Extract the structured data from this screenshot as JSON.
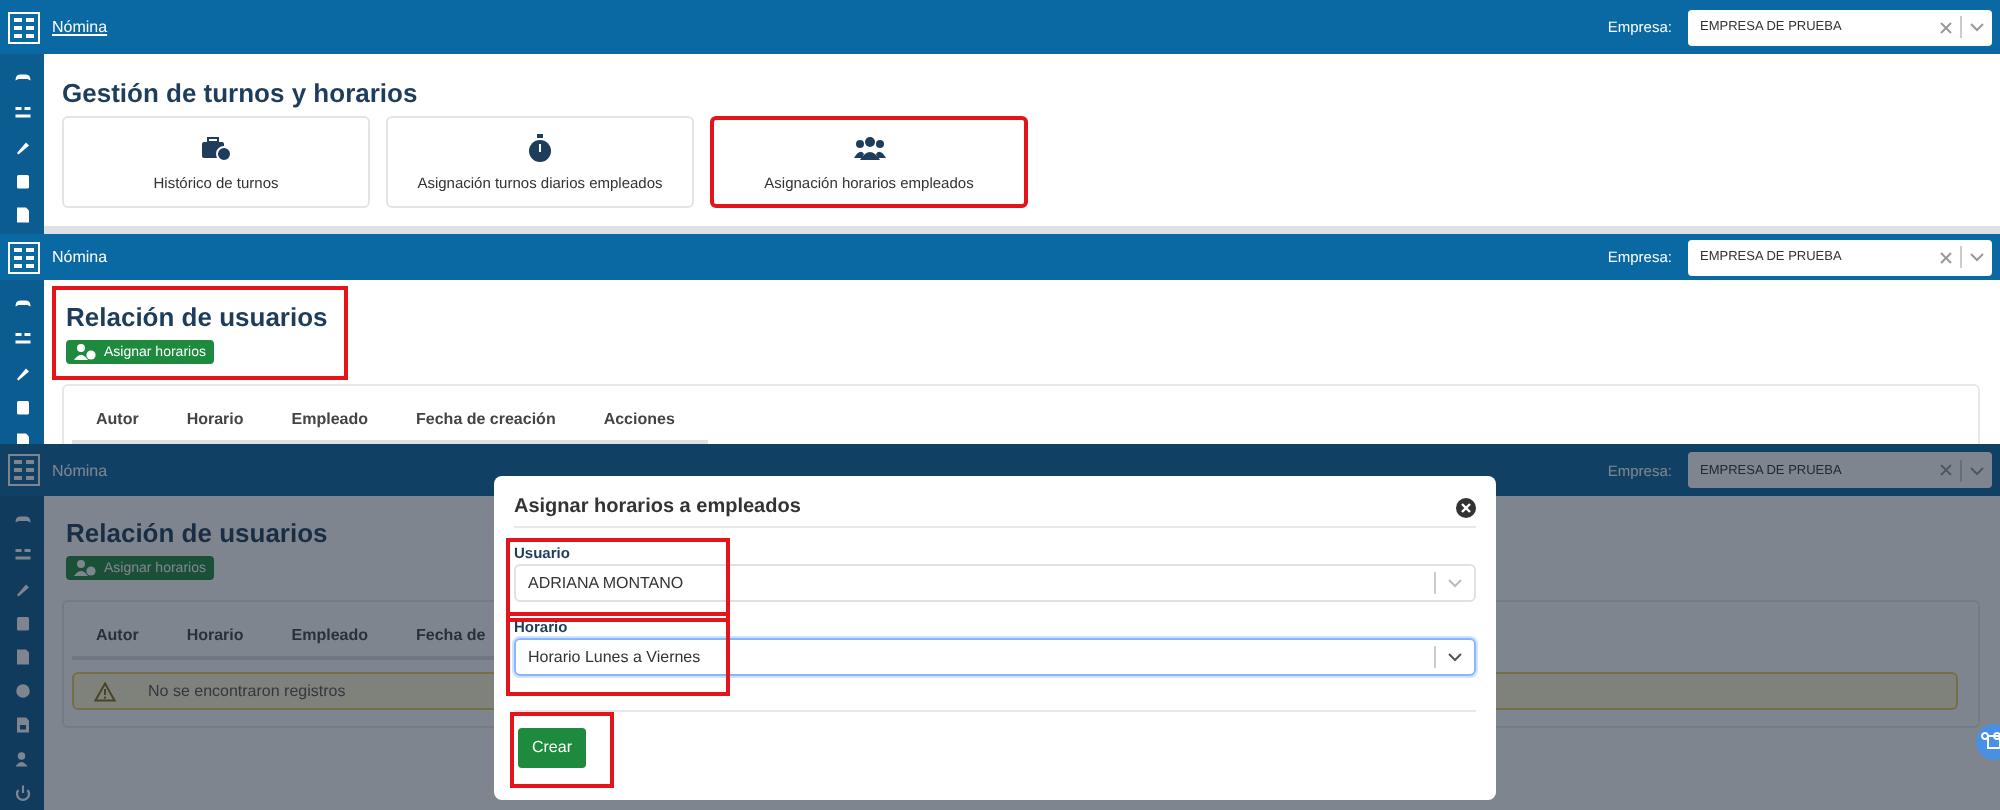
{
  "screens": [
    {
      "kind": "menu",
      "header": {
        "app_name": "Nómina",
        "underlined": true,
        "company_label": "Empresa:",
        "company_value": "EMPRESA DE PRUEBA"
      },
      "title": "Gestión de turnos y horarios",
      "cards": [
        {
          "label": "Histórico de turnos",
          "highlighted": false
        },
        {
          "label": "Asignación turnos diarios empleados",
          "highlighted": false
        },
        {
          "label": "Asignación horarios empleados",
          "highlighted": true
        }
      ]
    },
    {
      "kind": "list",
      "header": {
        "app_name": "Nómina",
        "underlined": false,
        "company_label": "Empresa:",
        "company_value": "EMPRESA DE PRUEBA"
      },
      "title": "Relación de usuarios",
      "action": "Asignar horarios",
      "highlighted": true,
      "columns": [
        "Autor",
        "Horario",
        "Empleado",
        "Fecha de creación",
        "Acciones"
      ]
    },
    {
      "kind": "modal",
      "header": {
        "app_name": "Nómina",
        "underlined": false,
        "company_label": "Empresa:",
        "company_value": "EMPRESA DE PRUEBA"
      },
      "title": "Relación de usuarios",
      "action": "Asignar horarios",
      "highlighted": false,
      "columns": [
        "Autor",
        "Horario",
        "Empleado",
        "Fecha de"
      ],
      "alert": "No se encontraron registros",
      "modal": {
        "title": "Asignar horarios a empleados",
        "fields": [
          {
            "label": "Usuario",
            "value": "ADRIANA MONTANO",
            "focused": false,
            "highlighted": true
          },
          {
            "label": "Horario",
            "value": "Horario Lunes a Viernes",
            "focused": true,
            "highlighted": true
          }
        ],
        "submit": "Crear",
        "submit_highlighted": true
      }
    }
  ]
}
